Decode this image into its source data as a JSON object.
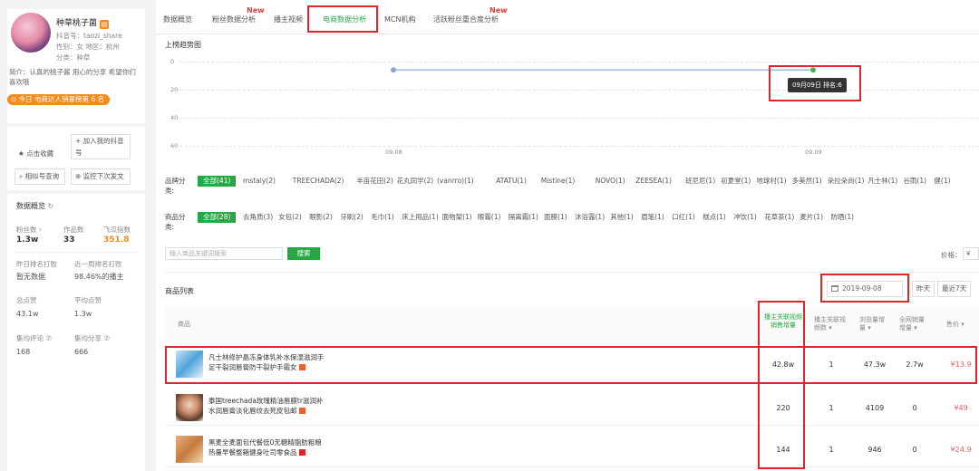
{
  "profile": {
    "name": "种草桃子菌",
    "douyin_id": "抖音号：taozi_share",
    "gender_region": "性别：女   地区：杭州",
    "category": "分类：种草",
    "bio": "简介：认真的桃子酱 用心的分享 希望你们喜欢哦",
    "rank_text": "今日 电商达人销量榜第 6 名"
  },
  "actions": {
    "favorite": "★ 点击收藏",
    "add_douyin": "+ 加入我的抖音号",
    "similar": "相似号查询",
    "monitor": "监控下次发文"
  },
  "overview": {
    "title": "数据概览",
    "fans_label": "粉丝数 ›",
    "fans_value": "1.3w",
    "works_label": "作品数",
    "works_value": "33",
    "index_label": "飞瓜指数",
    "index_value": "351.8",
    "yesterday_rank_label": "昨日排名打败",
    "yesterday_rank_value": "暂无数据",
    "week_rank_label": "近一周排名打败",
    "week_rank_value": "98.46%的播主",
    "likes_label": "总点赞",
    "likes_value": "43.1w",
    "avg_likes_label": "平均点赞",
    "avg_likes_value": "1.3w",
    "avg_comments_label": "集均评论 ⑦",
    "avg_comments_value": "168",
    "avg_shares_label": "集均分享 ⑦",
    "avg_shares_value": "666"
  },
  "tabs": [
    "数据概览",
    "粉丝数据分析",
    "播主视频",
    "电商数据分析",
    "MCN机构",
    "活跃粉丝重合度分析"
  ],
  "new_badge": "New",
  "trend": {
    "title": "上榜趋势图",
    "yticks": [
      "0",
      "20",
      "40",
      "60"
    ],
    "xticks": [
      "09.08",
      "09.09"
    ],
    "tooltip": "09月09日 排名:6"
  },
  "chart_data": {
    "type": "line",
    "title": "上榜趋势图",
    "x": [
      "09.08",
      "09.09"
    ],
    "series": [
      {
        "values": [
          6,
          6
        ]
      }
    ],
    "ylim": [
      0,
      60
    ],
    "y_inverted": true
  },
  "brand_filter": {
    "label": "品牌分类:",
    "all": "全部(41)",
    "options": [
      "mstaly(2)",
      "TREECHADA(2)",
      "半亩花田(2)",
      "花丸同学(2)",
      "(vanrro)(1)",
      "ATATU(1)",
      "Mistine(1)",
      "NOVO(1)",
      "ZEESEA(1)",
      "班尼尼(1)",
      "初夏堂(1)",
      "地球村(1)",
      "多美然(1)",
      "朵拉朵尚(1)",
      "凡士林(1)",
      "谷雨(1)",
      "健(1)"
    ]
  },
  "product_filter": {
    "label": "商品分类:",
    "all": "全部(28)",
    "options": [
      "去角质(3)",
      "女包(2)",
      "眼影(2)",
      "牙刷(2)",
      "毛巾(1)",
      "床上用品(1)",
      "面物架(1)",
      "眼霜(1)",
      "隔离霜(1)",
      "面膜(1)",
      "沐浴露(1)",
      "其他(1)",
      "眉笔(1)",
      "口红(1)",
      "糕点(1)",
      "冲饮(1)",
      "花草茶(1)",
      "麦片(1)",
      "防晒(1)"
    ]
  },
  "search": {
    "placeholder": "输入商品关键词搜索",
    "button": "搜索",
    "price_label": "价格：",
    "price_value": "¥"
  },
  "list": {
    "title": "商品列表",
    "date": "2019-09-08",
    "range_yesterday": "昨天",
    "range_week": "最近7天",
    "headers": {
      "product": "商品",
      "sales_incr": "播主关联视频销售增量",
      "videos": "播主关联视频数",
      "views": "浏览量增量",
      "all_sales": "全网销量增量",
      "price": "售价"
    },
    "rows": [
      {
        "name": "凡士林修护晶冻身体乳补水保湿滋润手足干裂润唇膏防干裂护手霜女",
        "sales": "42.8w",
        "videos": "1",
        "views": "47.3w",
        "all_sales": "2.7w",
        "price": "¥13.9"
      },
      {
        "name": "泰国treechada玫瑰精油唇膜tr滋润补水润唇膏淡化唇纹去死皮包邮",
        "sales": "220",
        "videos": "1",
        "views": "4109",
        "all_sales": "0",
        "price": "¥49"
      },
      {
        "name": "黑麦全麦面包代餐低0无糖精脂肪粗粮热量早餐整箱健身吐司零食品",
        "sales": "144",
        "videos": "1",
        "views": "946",
        "all_sales": "0",
        "price": "¥24.9"
      }
    ]
  }
}
